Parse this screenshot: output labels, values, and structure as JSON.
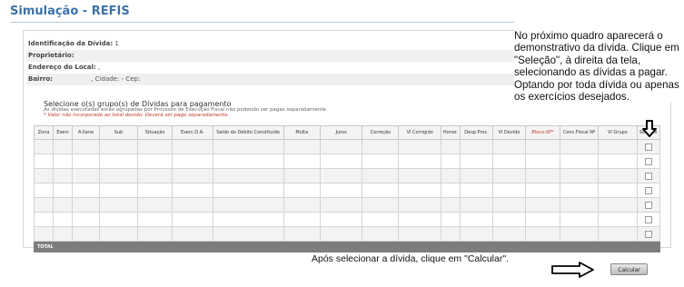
{
  "page": {
    "title": "Simulação - REFIS"
  },
  "info_rows": [
    {
      "label": "Identificação da Dívida:",
      "value": "1"
    },
    {
      "label": "Proprietário:",
      "value": ""
    },
    {
      "label": "Endereço do Local:",
      "value": ","
    },
    {
      "label": "Bairro:",
      "value": ", Cidade: - Cep:"
    }
  ],
  "selection": {
    "heading": "Selecione o(s) grupo(s) de Dívidas para pagamento",
    "note": "As dívidas executadas estão agrupadas por Processo de Execução Fiscal não podendo ser pagas separadamente.",
    "warning": "* Valor não incorporado ao total devido. Deverá ser pago separadamente."
  },
  "table": {
    "columns": [
      "Zona",
      "Exerc",
      "A.Ilane",
      "Sub",
      "Situação",
      "Exerc.D.A.",
      "Saldo do Débito Constituído",
      "Multa",
      "Juros",
      "Correção",
      "Vl Corrigido",
      "Honor.",
      "Desp.Proc.",
      "Vl Devido",
      "Bloco-SP*",
      "Conc.Fiscal Nº",
      "Vl Grupo",
      "Seleção"
    ],
    "red_column": "Bloco-SP*",
    "row_count": 7,
    "total_label": "TOTAL"
  },
  "callout": {
    "text": "No próximo quadro aparecerá o demonstrativo da dívida. Clique em \"Seleção\", à direita da tela, selecionando as dívidas a pagar. Optando por toda dívida ou apenas os exercícios desejados."
  },
  "footer": {
    "instruction": "Após selecionar a dívida, clique em \"Calcular\".",
    "button_label": "Calcular"
  },
  "colors": {
    "title": "#3d72a8",
    "total_row": "#7d7d7d",
    "warning": "#c0392b"
  }
}
